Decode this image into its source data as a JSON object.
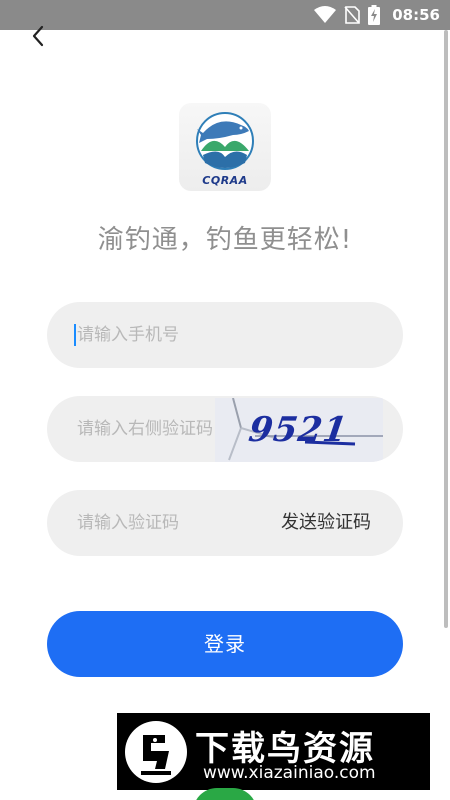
{
  "status_bar": {
    "time": "08:56",
    "icons": [
      "wifi-icon",
      "no-sim-icon",
      "battery-charging-icon"
    ]
  },
  "nav": {
    "back_icon": "chevron-left-icon"
  },
  "logo": {
    "text": "CQRAA"
  },
  "slogan": "渝钓通，钓鱼更轻松!",
  "form": {
    "phone_placeholder": "请输入手机号",
    "captcha_placeholder": "请输入右侧验证码",
    "captcha_code": "9521",
    "sms_placeholder": "请输入验证码",
    "send_code_label": "发送验证码",
    "login_label": "登录"
  },
  "watermark": {
    "title": "下载鸟资源",
    "url": "www.xiazainiao.com"
  },
  "colors": {
    "accent": "#1e6ef4",
    "field_bg": "#efefef",
    "placeholder": "#b8b8b8",
    "status_bar": "#8a8a8a"
  }
}
